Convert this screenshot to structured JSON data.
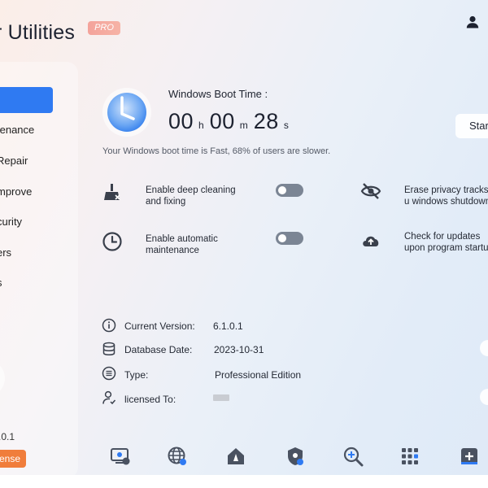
{
  "header": {
    "app_title": "r Utilities",
    "badge": "PRO",
    "user_icon": "user-icon"
  },
  "sidebar": {
    "items": [
      {
        "label": "",
        "active": true
      },
      {
        "label": "tenance"
      },
      {
        "label": "Repair"
      },
      {
        "label": "mprove"
      },
      {
        "label": "curity"
      },
      {
        "label": "ers"
      },
      {
        "label": "s"
      }
    ],
    "version": ".0.1",
    "license_button": "ense"
  },
  "boot": {
    "label": "Windows Boot Time :",
    "hours": "00",
    "hours_unit": "h",
    "minutes": "00",
    "minutes_unit": "m",
    "seconds": "28",
    "seconds_unit": "s",
    "start_button": "Star",
    "message": "Your Windows boot time is Fast, 68% of users are slower."
  },
  "features": [
    {
      "icon": "broom-icon",
      "label": "Enable deep cleaning and fixing",
      "toggle": false
    },
    {
      "icon": "clock-icon",
      "label": "Enable automatic maintenance",
      "toggle": false
    },
    {
      "icon": "eye-off-icon",
      "label": "Erase privacy tracks u windows shutdown"
    },
    {
      "icon": "cloud-upload-icon",
      "label": "Check for updates upon program startu"
    }
  ],
  "info": {
    "version_label": "Current Version:",
    "version_value": "6.1.0.1",
    "db_label": "Database Date:",
    "db_value": "2023-10-31",
    "type_label": "Type:",
    "type_value": "Professional Edition",
    "licensed_label": "licensed To:"
  },
  "toolbar": [
    "monitor-settings-icon",
    "globe-settings-icon",
    "home-rocket-icon",
    "shield-icon",
    "zoom-in-icon",
    "apps-grid-icon",
    "add-box-icon"
  ],
  "colors": {
    "accent": "#2f7af2",
    "license": "#f07d3b",
    "badge": "#f4a39b",
    "toggle_off": "#7b8594"
  }
}
